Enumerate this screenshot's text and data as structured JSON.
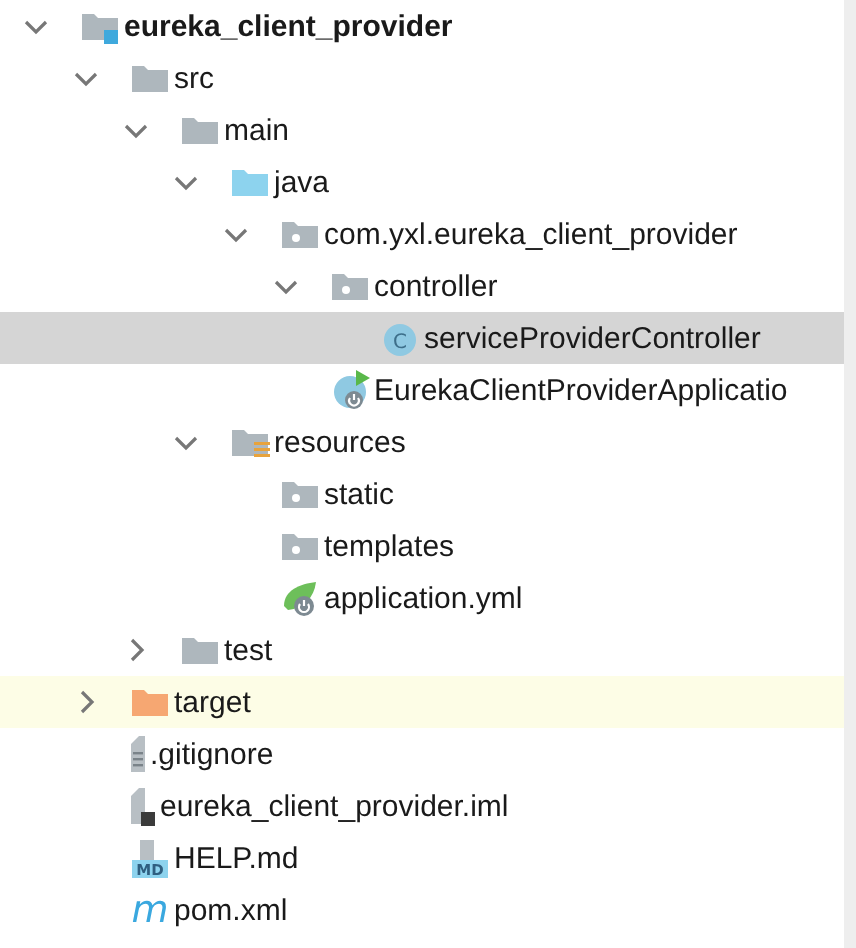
{
  "tree": [
    {
      "label": "eureka_client_provider",
      "kind": "module",
      "bold": true,
      "expanded": true,
      "children": [
        {
          "label": "src",
          "kind": "folder",
          "expanded": true,
          "children": [
            {
              "label": "main",
              "kind": "folder",
              "expanded": true,
              "children": [
                {
                  "label": "java",
                  "kind": "source-folder",
                  "expanded": true,
                  "children": [
                    {
                      "label": "com.yxl.eureka_client_provider",
                      "kind": "package",
                      "expanded": true,
                      "children": [
                        {
                          "label": "controller",
                          "kind": "package",
                          "expanded": true,
                          "children": [
                            {
                              "label": "serviceProviderController",
                              "kind": "class",
                              "icon_text": "C",
                              "selected": true
                            }
                          ]
                        },
                        {
                          "label": "EurekaClientProviderApplicatio",
                          "kind": "boot-class",
                          "selected": false
                        }
                      ]
                    }
                  ]
                },
                {
                  "label": "resources",
                  "kind": "resources-folder",
                  "expanded": true,
                  "children": [
                    {
                      "label": "static",
                      "kind": "package",
                      "selected": false
                    },
                    {
                      "label": "templates",
                      "kind": "package",
                      "selected": false
                    },
                    {
                      "label": "application.yml",
                      "kind": "spring-config",
                      "selected": false
                    }
                  ]
                }
              ]
            },
            {
              "label": "test",
              "kind": "folder",
              "expanded": false
            }
          ]
        },
        {
          "label": "target",
          "kind": "excluded-folder",
          "expanded": false,
          "highlighted": true
        },
        {
          "label": ".gitignore",
          "kind": "text-file",
          "selected": false
        },
        {
          "label": "eureka_client_provider.iml",
          "kind": "iml-file",
          "selected": false
        },
        {
          "label": "HELP.md",
          "kind": "markdown",
          "icon_text": "MD",
          "selected": false
        },
        {
          "label": "pom.xml",
          "kind": "maven",
          "icon_text": "m",
          "selected": false
        }
      ]
    }
  ]
}
